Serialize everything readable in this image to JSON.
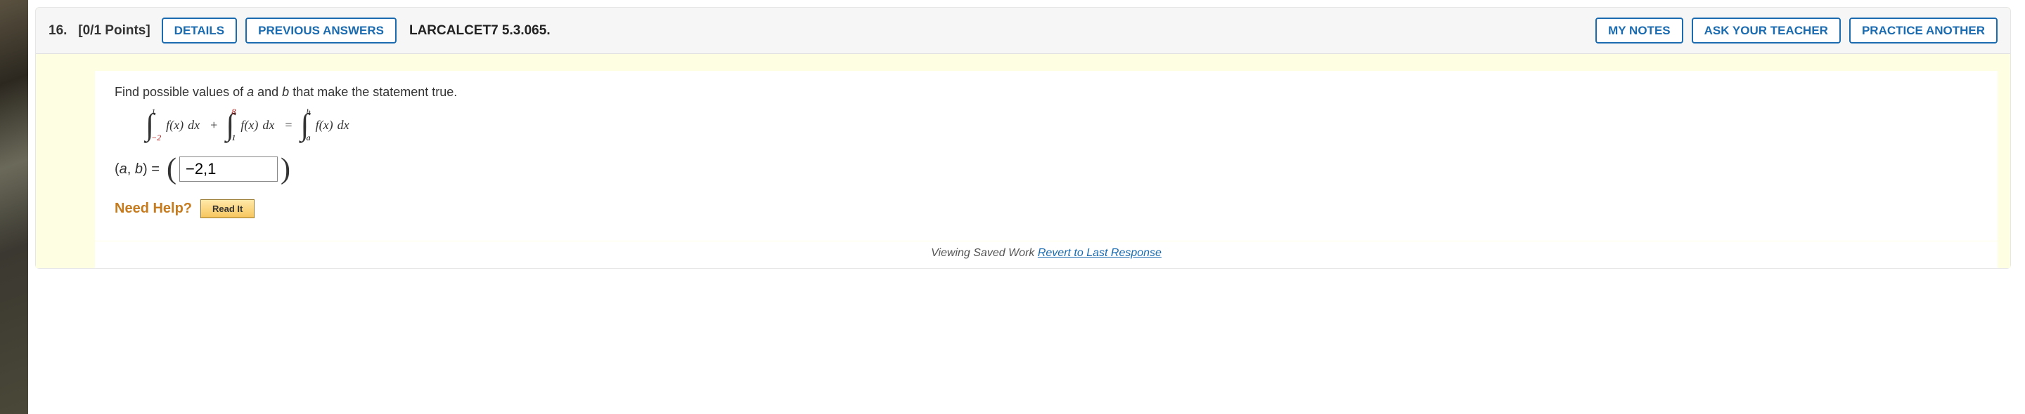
{
  "header": {
    "number": "16.",
    "points": "[0/1 Points]",
    "details_label": "DETAILS",
    "previous_label": "PREVIOUS ANSWERS",
    "reference": "LARCALCET7 5.3.065.",
    "my_notes_label": "MY NOTES",
    "ask_teacher_label": "ASK YOUR TEACHER",
    "practice_label": "PRACTICE ANOTHER"
  },
  "question": {
    "prompt_pre": "Find possible values of ",
    "var_a": "a",
    "prompt_mid": " and ",
    "var_b": "b",
    "prompt_post": " that make the statement true."
  },
  "math": {
    "int1_upper": "1",
    "int1_lower": "−2",
    "int2_upper": "8",
    "int2_lower": "1",
    "int3_upper": "b",
    "int3_lower": "a",
    "integrand": "f(x)",
    "dx": "dx",
    "plus": "+",
    "eq": "="
  },
  "answer": {
    "label_open": "(",
    "label_a": "a",
    "label_comma": ", ",
    "label_b": "b",
    "label_close": ")",
    "equals": " = ",
    "value": "−2,1"
  },
  "help": {
    "need_help": "Need Help?",
    "read_it": "Read It"
  },
  "footer": {
    "text": "Viewing Saved Work ",
    "link": "Revert to Last Response"
  }
}
